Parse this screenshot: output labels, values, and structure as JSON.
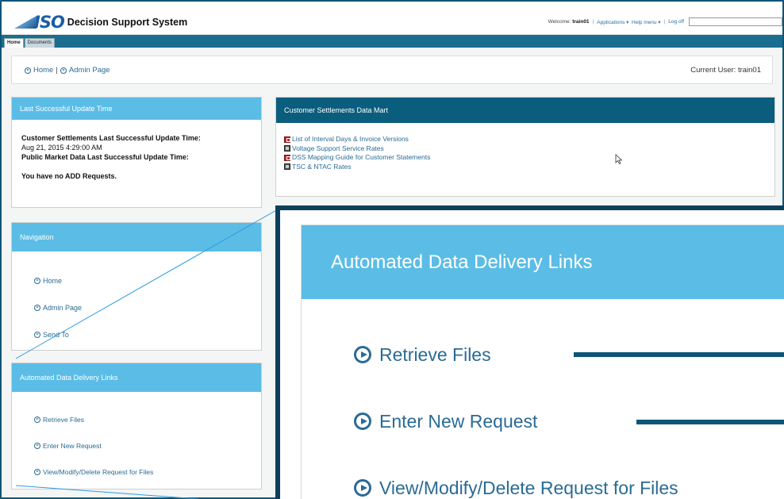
{
  "header": {
    "logo_text": "ISO",
    "app_title": "Decision Support System",
    "welcome_prefix": "Welcome:",
    "welcome_user": "train01",
    "applications": "Applications ▾",
    "help_menu": "Help menu ▾",
    "separator": "|",
    "logoff": "Log off"
  },
  "tabs": [
    {
      "label": "Home"
    },
    {
      "label": "Documents"
    }
  ],
  "breadcrumb": {
    "home": "Home",
    "separator": "|",
    "admin": "Admin Page",
    "current_user": "Current User: train01"
  },
  "update_panel": {
    "title": "Last Successful Update Time",
    "cs_label": "Customer Settlements Last Successful Update Time:",
    "cs_value": "Aug 21, 2015 4:29:00 AM",
    "pm_label": "Public Market Data Last Successful Update Time:",
    "add_message": "You have no ADD Requests."
  },
  "mart_panel": {
    "title": "Customer Settlements Data Mart",
    "links": [
      {
        "label": "List of Interval Days & Invoice Versions",
        "icon": "pdf-icon"
      },
      {
        "label": "Voltage Support Service Rates",
        "icon": "spreadsheet-icon"
      },
      {
        "label": "DSS Mapping Guide for Customer Statements",
        "icon": "pdf-icon"
      },
      {
        "label": "TSC & NTAC Rates",
        "icon": "spreadsheet-icon"
      }
    ]
  },
  "nav_panel": {
    "title": "Navigation",
    "items": [
      {
        "label": "Home"
      },
      {
        "label": "Admin Page"
      },
      {
        "label": "Send To"
      }
    ]
  },
  "add_panel": {
    "title": "Automated Data Delivery Links",
    "items": [
      {
        "label": "Retrieve Files"
      },
      {
        "label": "Enter New Request"
      },
      {
        "label": "View/Modify/Delete Request for Files"
      }
    ]
  },
  "zoom_callout": {
    "title": "Automated Data Delivery Links",
    "items": [
      {
        "label": "Retrieve Files"
      },
      {
        "label": "Enter New Request"
      },
      {
        "label": "View/Modify/Delete Request for Files"
      }
    ]
  },
  "colors": {
    "accent": "#5bbde6",
    "dark_header": "#0b5d7e",
    "link": "#2a6b95",
    "frame": "#0d3f5c"
  }
}
